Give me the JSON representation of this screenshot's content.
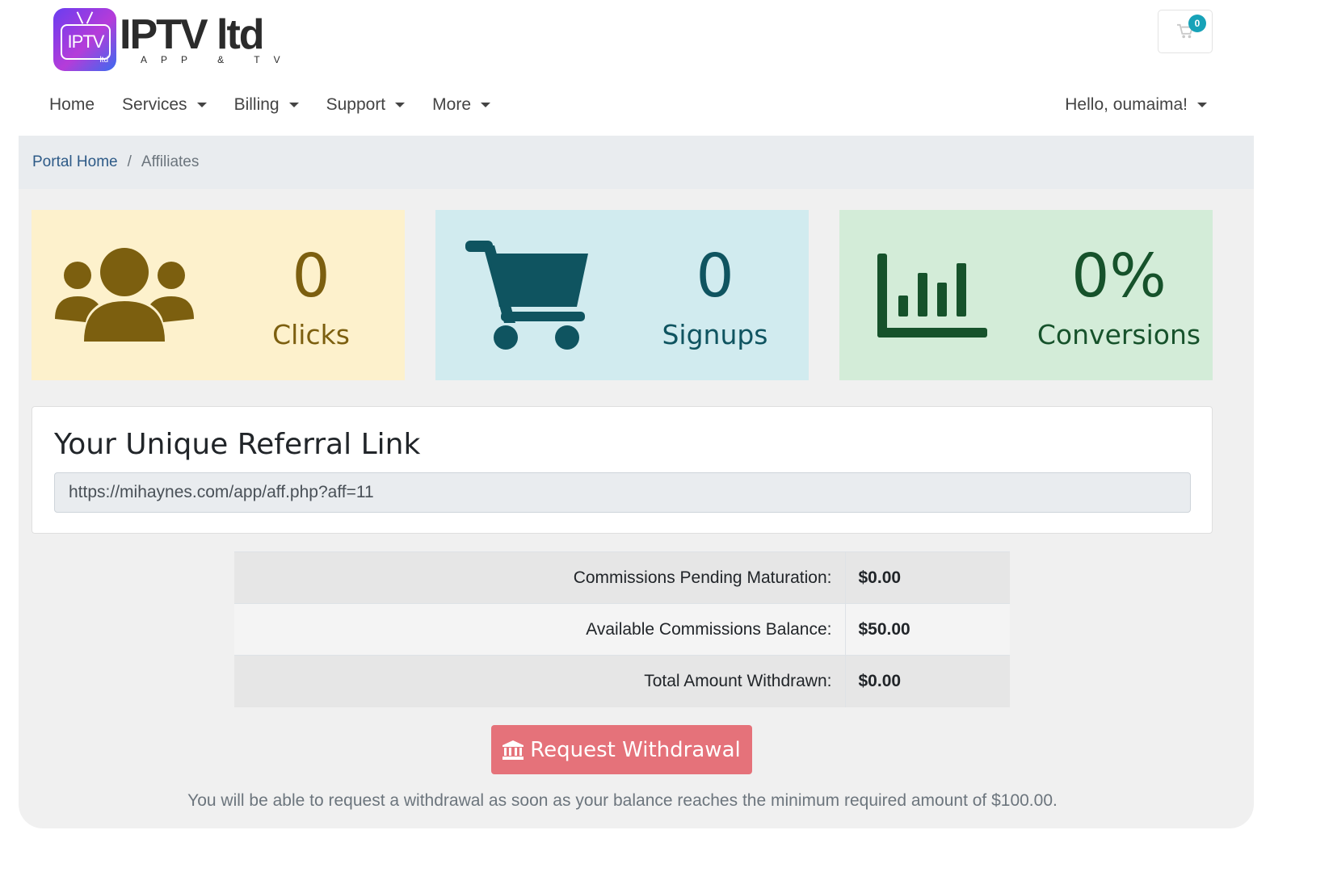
{
  "logo": {
    "badge_text": "IPTV",
    "badge_sub": "ltd",
    "brand": "IPTV ltd",
    "tagline": "APP & TV"
  },
  "cart": {
    "count": "0"
  },
  "nav": {
    "home": "Home",
    "services": "Services",
    "billing": "Billing",
    "support": "Support",
    "more": "More",
    "user_greeting": "Hello, oumaima!"
  },
  "breadcrumb": {
    "home": "Portal Home",
    "separator": "/",
    "current": "Affiliates"
  },
  "stats": {
    "clicks": {
      "value": "0",
      "label": "Clicks"
    },
    "signups": {
      "value": "0",
      "label": "Signups"
    },
    "conversions": {
      "value": "0%",
      "label": "Conversions"
    }
  },
  "referral": {
    "title": "Your Unique Referral Link",
    "url": "https://mihaynes.com/app/aff.php?aff=11"
  },
  "commissions": [
    {
      "label": "Commissions Pending Maturation:",
      "value": "$0.00"
    },
    {
      "label": "Available Commissions Balance:",
      "value": "$50.00"
    },
    {
      "label": "Total Amount Withdrawn:",
      "value": "$0.00"
    }
  ],
  "withdraw": {
    "button_label": "Request Withdrawal",
    "note": "You will be able to request a withdrawal as soon as your balance reaches the minimum required amount of $100.00."
  },
  "colors": {
    "clicks_bg": "#fdf1cc",
    "signups_bg": "#d1ebef",
    "conversions_bg": "#d3ecd8",
    "withdraw_button": "#e5727a",
    "link": "#2d5a87"
  },
  "icons": {
    "clicks": "users-icon",
    "signups": "shopping-cart-icon",
    "conversions": "bar-chart-icon",
    "withdraw": "bank-icon",
    "cart": "cart-icon"
  }
}
